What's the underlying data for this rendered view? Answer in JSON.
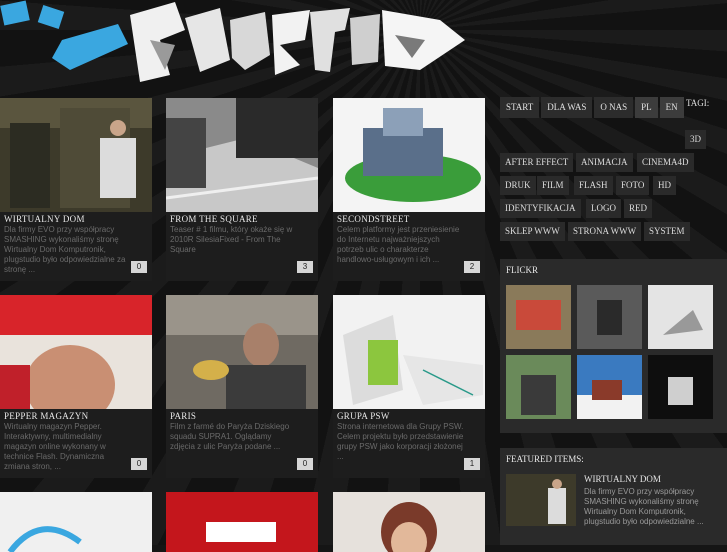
{
  "logo": {
    "text": "FLUSTUDIO"
  },
  "nav": {
    "items": [
      "START",
      "DLA WAS",
      "O NAS"
    ],
    "langs": [
      "PL",
      "EN"
    ],
    "tags_label": "TAGI:"
  },
  "tags": [
    "3D",
    "AFTER EFFECT",
    "ANIMACJA",
    "CINEMA4D",
    "DRUK",
    "FILM",
    "FLASH",
    "FOTO",
    "HD",
    "IDENTYFIKACJA",
    "LOGO",
    "RED",
    "SKLEP WWW",
    "STRONA WWW",
    "SYSTEM"
  ],
  "cards": [
    {
      "title": "WIRTUALNY DOM",
      "desc": "Dla firmy EVO przy współpracy SMASHING wykonaliśmy stronę Wirtualny Dom Komputronik, plugstudio było odpowiedzialne za stronę ...",
      "count": "0"
    },
    {
      "title": "FROM THE SQUARE",
      "desc": "Teaser # 1 filmu, który okaże się w 2010R SilesiaFixed - From The Square",
      "count": "3"
    },
    {
      "title": "SECONDSTREET",
      "desc": "Celem platformy jest przeniesienie do Internetu najważniejszych potrzeb ulic o charakterze handlowo-usługowym i ich ...",
      "count": "2"
    },
    {
      "title": "PEPPER MAGAZYN",
      "desc": "Wirtualny magazyn Pepper. Interaktywny, multimedialny magazyn online wykonany w technice Flash. Dynamiczna zmiana stron, ...",
      "count": "0"
    },
    {
      "title": "PARIS",
      "desc": "Film z farmé do Paryża Dziskiego squadu SUPRA1. Oglądamy zdjęcia z ulic Paryża podane ...",
      "count": "0"
    },
    {
      "title": "GRUPA PSW",
      "desc": "Strona internetowa dla Grupy PSW. Celem projektu było przedstawienie grupy PSW jako korporacji złożonej ...",
      "count": "1"
    }
  ],
  "flickr": {
    "heading": "FLICKR"
  },
  "featured": {
    "heading": "FEATURED ITEMS:",
    "title": "WIRTUALNY DOM",
    "desc": "Dla firmy EVO przy współpracy SMASHING wykonaliśmy stronę Wirtualny Dom Komputronik, plugstudio było odpowiedzialne ..."
  },
  "colors": {
    "accent_blue": "#3aa7e0",
    "panel": "#2a2a2a",
    "bg": "#151515"
  }
}
